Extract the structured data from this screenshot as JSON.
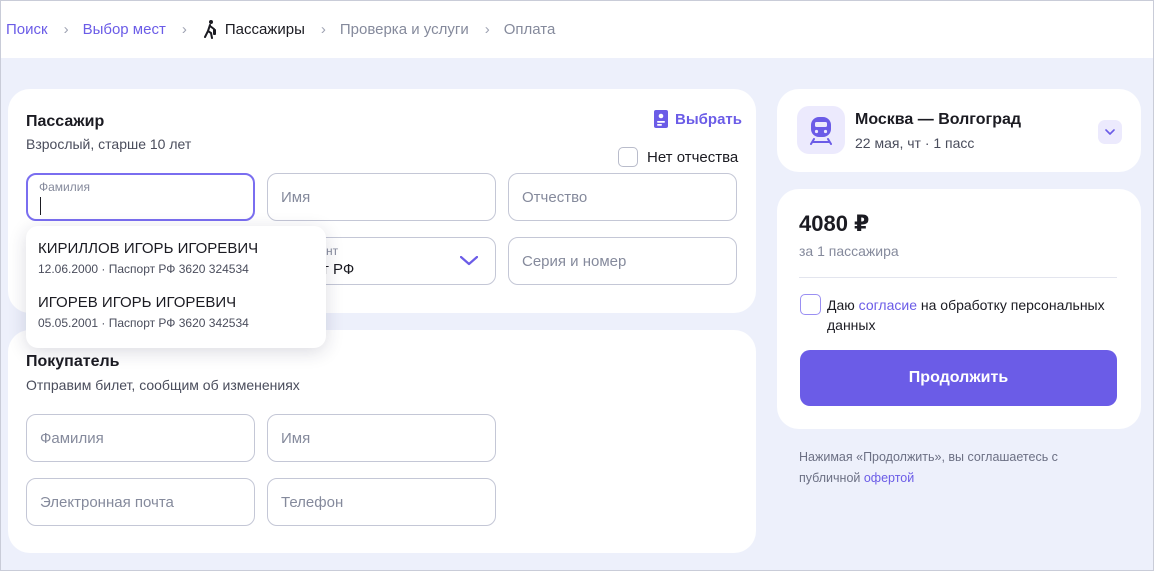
{
  "breadcrumb": {
    "items": [
      {
        "label": "Поиск",
        "state": "done"
      },
      {
        "label": "Выбор мест",
        "state": "done"
      },
      {
        "label": "Пассажиры",
        "state": "current"
      },
      {
        "label": "Проверка и услуги",
        "state": "future"
      },
      {
        "label": "Оплата",
        "state": "future"
      }
    ],
    "separator": "›"
  },
  "passenger": {
    "title": "Пассажир",
    "subtitle": "Взрослый, старше 10 лет",
    "choose_label": "Выбрать",
    "no_patronymic_label": "Нет отчества",
    "surname_label": "Фамилия",
    "name_placeholder": "Имя",
    "patronymic_placeholder": "Отчество",
    "document_label_partial": "нт",
    "document_value_partial": "от РФ",
    "series_placeholder": "Серия и номер",
    "suggestions": [
      {
        "name": "КИРИЛЛОВ ИГОРЬ ИГОРЕВИЧ",
        "meta": "12.06.2000 · Паспорт РФ 3620 324534"
      },
      {
        "name": "ИГОРЕВ ИГОРЬ ИГОРЕВИЧ",
        "meta": "05.05.2001 · Паспорт РФ 3620 342534"
      }
    ]
  },
  "buyer": {
    "title": "Покупатель",
    "subtitle": "Отправим билет, сообщим об изменениях",
    "surname_placeholder": "Фамилия",
    "name_placeholder": "Имя",
    "email_placeholder": "Электронная почта",
    "phone_placeholder": "Телефон"
  },
  "trip": {
    "route": "Москва — Волгоград",
    "details": "22 мая, чт · 1 пасс"
  },
  "summary": {
    "price": "4080 ₽",
    "price_note": "за 1 пассажира",
    "consent_prefix": "Даю ",
    "consent_link": "согласие",
    "consent_suffix": " на обработку персональных данных",
    "continue_label": "Продолжить",
    "disclaimer_text": "Нажимая «Продолжить», вы соглашаетесь с публичной ",
    "offer_link": "офертой"
  },
  "colors": {
    "accent": "#6b5ce7",
    "background": "#edf0fb",
    "card": "#ffffff",
    "text": "#1b1b22",
    "muted": "#858a9c"
  }
}
